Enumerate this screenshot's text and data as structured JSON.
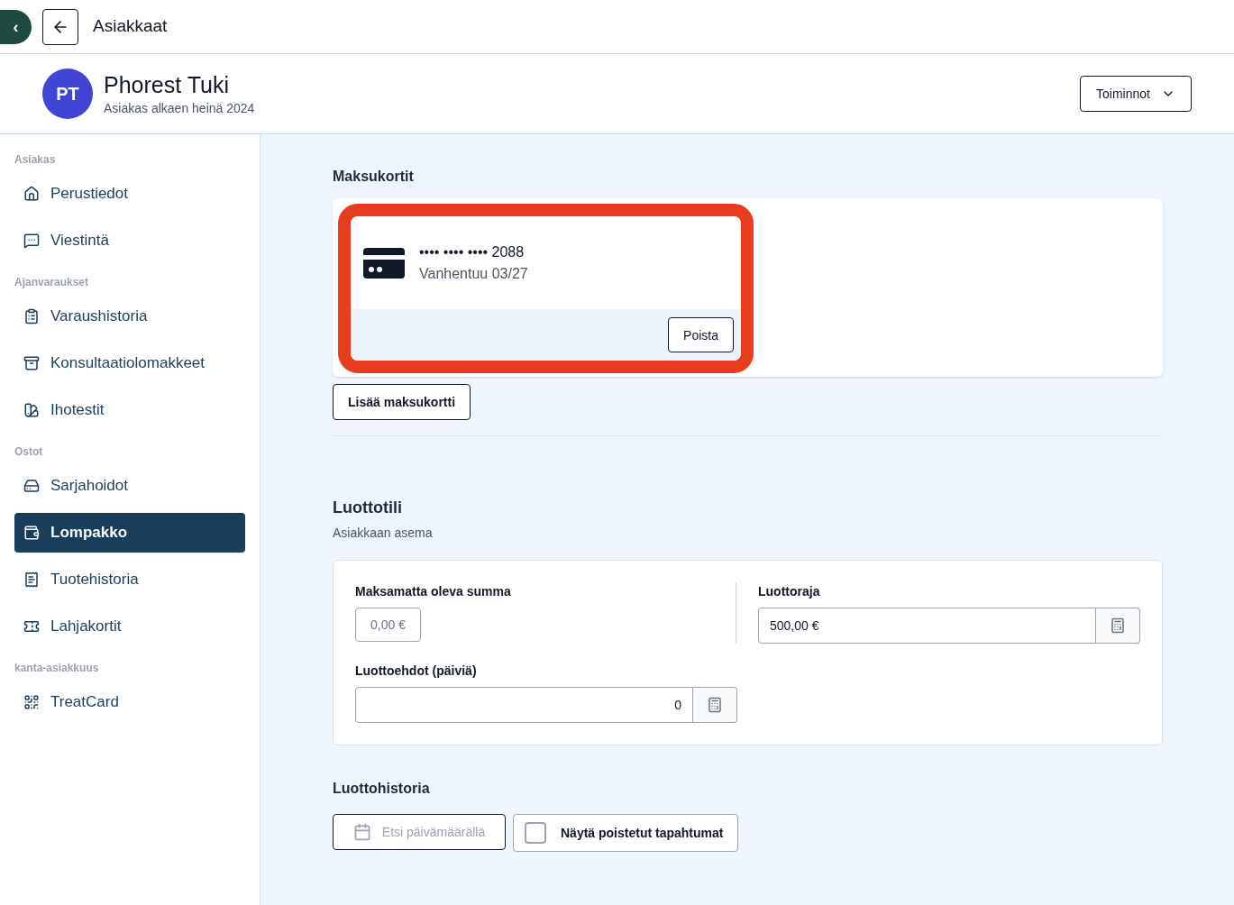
{
  "top_bar": {
    "collapse_icon_button": "‹",
    "title": "Asiakkaat"
  },
  "customer": {
    "initials": "PT",
    "name": "Phorest Tuki",
    "subtitle": "Asiakas alkaen heinä 2024",
    "actions_button": "Toiminnot"
  },
  "sidebar": {
    "sections": [
      {
        "title": "Asiakas",
        "items": [
          {
            "label": "Perustiedot",
            "kind": "home",
            "selected": false
          },
          {
            "label": "Viestintä",
            "kind": "message",
            "selected": false
          }
        ]
      },
      {
        "title": "Ajanvaraukset",
        "items": [
          {
            "label": "Varaushistoria",
            "kind": "clipboard",
            "selected": false
          },
          {
            "label": "Konsultaatiolomakkeet",
            "kind": "archive",
            "selected": false
          },
          {
            "label": "Ihotestit",
            "kind": "swatch",
            "selected": false
          }
        ]
      },
      {
        "title": "Ostot",
        "items": [
          {
            "label": "Sarjahoidot",
            "kind": "stack",
            "selected": false
          },
          {
            "label": "Lompakko",
            "kind": "wallet",
            "selected": true
          },
          {
            "label": "Tuotehistoria",
            "kind": "receipt",
            "selected": false
          },
          {
            "label": "Lahjakortit",
            "kind": "ticket",
            "selected": false
          }
        ]
      },
      {
        "title": "kanta-asiakkuus",
        "items": [
          {
            "label": "TreatCard",
            "kind": "qr",
            "selected": false
          }
        ]
      }
    ]
  },
  "payment_cards": {
    "title": "Maksukortit",
    "cards": [
      {
        "number": "•••• •••• •••• 2088",
        "expiry": "Vanhentuu 03/27",
        "remove_button": "Poista",
        "highlighted": true
      }
    ],
    "add_button": "Lisää maksukortti"
  },
  "credit_account": {
    "title": "Luottotili",
    "subtitle": "Asiakkaan asema",
    "outstanding_label": "Maksamatta oleva summa",
    "outstanding_value": "0,00 €",
    "limit_label": "Luottoraja",
    "limit_value": "500,00 €",
    "terms_label": "Luottoehdot (päiviä)",
    "terms_value": "0"
  },
  "credit_history": {
    "title": "Luottohistoria",
    "date_search_placeholder": "Etsi päivämäärällä",
    "show_deleted": {
      "label": "Näytä poistetut tapahtumat",
      "checked": false
    }
  }
}
